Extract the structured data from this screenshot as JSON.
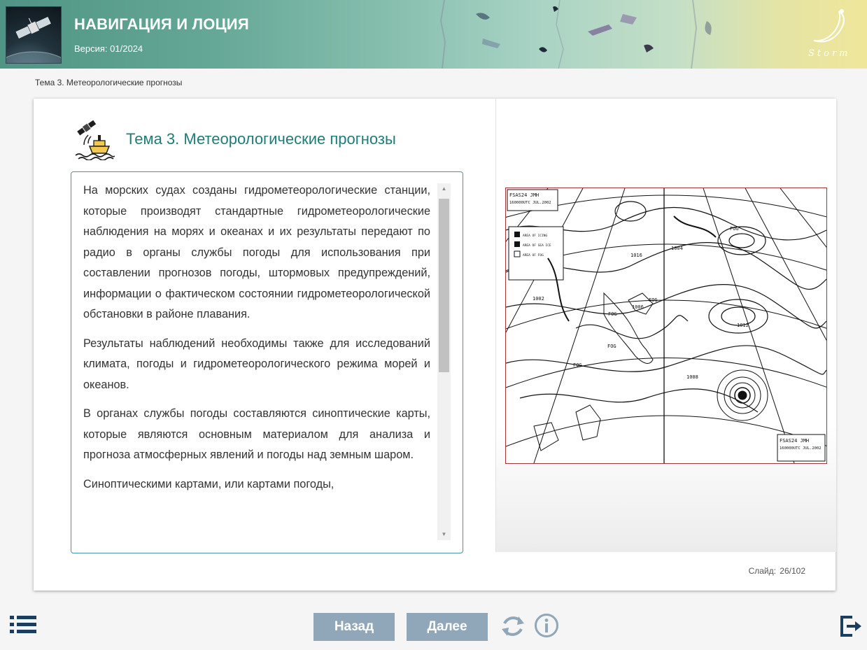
{
  "app": {
    "title": "НАВИГАЦИЯ И ЛОЦИЯ",
    "version": "Версия: 01/2024",
    "brand": "Storm"
  },
  "breadcrumb": "Тема 3. Метеорологические прогнозы",
  "slide": {
    "title": "Тема 3. Метеорологические прогнозы",
    "paragraphs": [
      "На морских судах созданы гидрометеорологические станции, которые производят стандартные гидрометеорологические наблюдения на морях и океанах и их результаты передают по радио в органы службы погоды для использования при составлении прогнозов погоды, штормовых предупреждений, информации о фактическом состоянии гидрометеорологической обстановки в районе плавания.",
      "Результаты наблюдений необходимы также для исследований климата, погоды и гидрометеорологического режима морей и океанов.",
      "В органах службы погоды составляются синоптические карты, которые являются основным материалом для анализа и прогноза атмосферных явлений и погоды над земным шаром.",
      "Синоптическими картами, или картами погоды,"
    ],
    "counter_label": "Слайд:",
    "counter_value": "26/102"
  },
  "weather_map": {
    "header_top": [
      "FSAS24 JMH",
      "160000UTC JUL.2002"
    ],
    "legend": [
      "AREA OF ICING",
      "AREA OF SEA ICE",
      "AREA OF FOG"
    ],
    "header_bottom": [
      "FSAS24 JMH",
      "160000UTC JUL.2002"
    ],
    "pressures": [
      "1004",
      "1016",
      "1002",
      "1006",
      "1008",
      "1012"
    ],
    "labels": [
      "FOG",
      "FOG",
      "FOG",
      "FOG",
      "FOG"
    ]
  },
  "nav": {
    "back_label": "Назад",
    "next_label": "Далее"
  },
  "colors": {
    "accent": "#1e7d78",
    "button": "#8fa7b9",
    "icon": "#1c3e5e",
    "panel_border": "#4b8fb3"
  }
}
